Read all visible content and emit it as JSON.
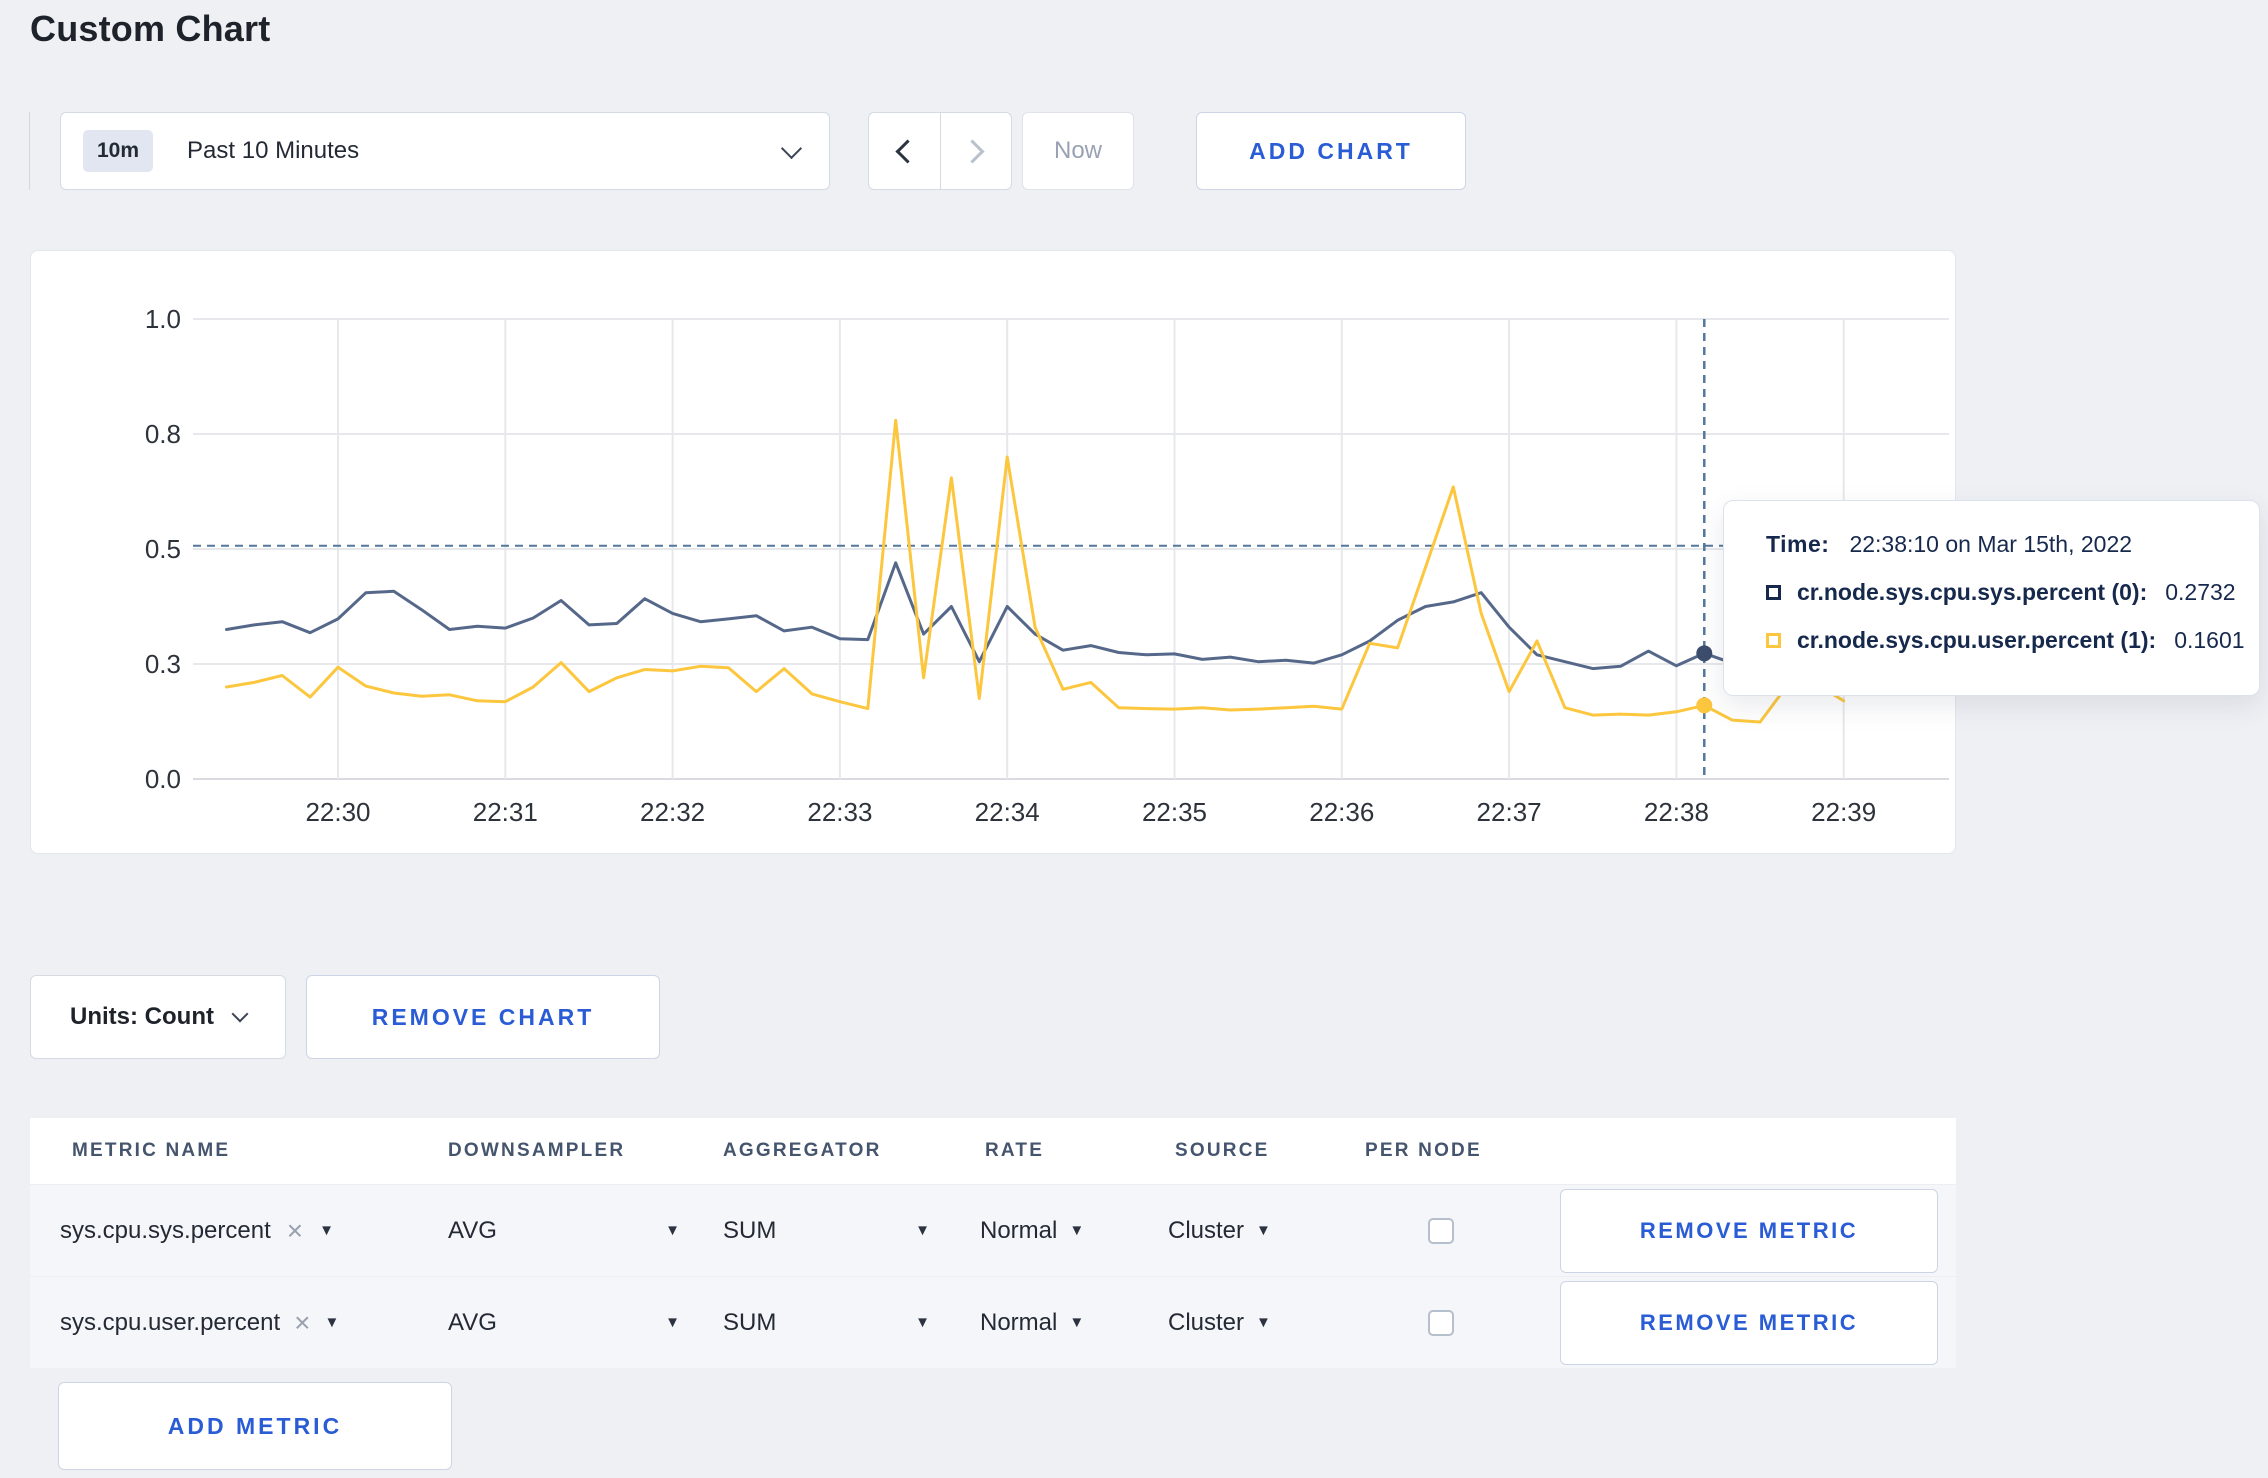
{
  "page": {
    "title": "Custom Chart"
  },
  "toolbar": {
    "range_badge": "10m",
    "range_label": "Past 10 Minutes",
    "prev_icon": "chevron-left",
    "next_icon": "chevron-right",
    "now_label": "Now",
    "add_chart_label": "ADD CHART"
  },
  "chart_data": {
    "type": "line",
    "title": "",
    "xlabel": "",
    "ylabel": "",
    "ylim": [
      0,
      1
    ],
    "grid": true,
    "y_ticks": [
      {
        "value": 0.0,
        "label": "0.0"
      },
      {
        "value": 0.25,
        "label": "0.3"
      },
      {
        "value": 0.5,
        "label": "0.5"
      },
      {
        "value": 0.75,
        "label": "0.8"
      },
      {
        "value": 1.0,
        "label": "1.0"
      }
    ],
    "x_ticks": [
      "22:30",
      "22:31",
      "22:32",
      "22:33",
      "22:34",
      "22:35",
      "22:36",
      "22:37",
      "22:38",
      "22:39"
    ],
    "x_start_offset_seconds": -40,
    "x_step_seconds": 10,
    "series": [
      {
        "name": "cr.node.sys.cpu.sys.percent",
        "color": "#56688a",
        "values": [
          0.325,
          0.335,
          0.342,
          0.318,
          0.348,
          0.405,
          0.408,
          0.368,
          0.325,
          0.332,
          0.328,
          0.35,
          0.388,
          0.335,
          0.338,
          0.392,
          0.36,
          0.342,
          0.348,
          0.355,
          0.322,
          0.33,
          0.305,
          0.303,
          0.47,
          0.315,
          0.375,
          0.255,
          0.375,
          0.315,
          0.28,
          0.29,
          0.275,
          0.27,
          0.272,
          0.26,
          0.265,
          0.255,
          0.258,
          0.252,
          0.27,
          0.3,
          0.345,
          0.375,
          0.385,
          0.405,
          0.33,
          0.27,
          0.255,
          0.24,
          0.245,
          0.278,
          0.246,
          0.2732,
          0.252,
          0.26,
          0.27,
          0.265,
          0.27
        ]
      },
      {
        "name": "cr.node.sys.cpu.user.percent",
        "color": "#fcc73e",
        "values": [
          0.2,
          0.21,
          0.225,
          0.178,
          0.243,
          0.202,
          0.187,
          0.18,
          0.183,
          0.17,
          0.168,
          0.2,
          0.253,
          0.19,
          0.22,
          0.238,
          0.235,
          0.245,
          0.242,
          0.19,
          0.24,
          0.185,
          0.168,
          0.153,
          0.78,
          0.22,
          0.655,
          0.175,
          0.7,
          0.33,
          0.195,
          0.21,
          0.155,
          0.153,
          0.152,
          0.155,
          0.15,
          0.152,
          0.155,
          0.158,
          0.152,
          0.295,
          0.285,
          0.46,
          0.635,
          0.36,
          0.19,
          0.3,
          0.155,
          0.139,
          0.141,
          0.139,
          0.146,
          0.1601,
          0.128,
          0.124,
          0.205,
          0.207,
          0.17
        ]
      }
    ],
    "hover": {
      "index": 53,
      "crosshair_value": 0.507
    },
    "legend_position": "tooltip"
  },
  "tooltip": {
    "time_label": "Time:",
    "time_value": "22:38:10 on Mar 15th, 2022",
    "rows": [
      {
        "label": "cr.node.sys.cpu.sys.percent (0):",
        "value": "0.2732",
        "color": "#16294d"
      },
      {
        "label": "cr.node.sys.cpu.user.percent (1):",
        "value": "0.1601",
        "color": "#fcc73e"
      }
    ]
  },
  "units_row": {
    "units_label": "Units: Count",
    "remove_chart_label": "REMOVE CHART"
  },
  "table": {
    "headers": [
      "METRIC NAME",
      "DOWNSAMPLER",
      "AGGREGATOR",
      "RATE",
      "SOURCE",
      "PER NODE"
    ],
    "rows": [
      {
        "metric": "sys.cpu.sys.percent",
        "downsampler": "AVG",
        "aggregator": "SUM",
        "rate": "Normal",
        "source": "Cluster",
        "per_node_checked": false,
        "remove_label": "REMOVE METRIC"
      },
      {
        "metric": "sys.cpu.user.percent",
        "downsampler": "AVG",
        "aggregator": "SUM",
        "rate": "Normal",
        "source": "Cluster",
        "per_node_checked": false,
        "remove_label": "REMOVE METRIC"
      }
    ],
    "add_metric_label": "ADD METRIC"
  },
  "colors": {
    "accent_blue": "#2a5cd6",
    "series_sys": "#56688a",
    "series_user": "#fcc73e",
    "crosshair": "#54779c",
    "grid": "#e7e8eb"
  }
}
